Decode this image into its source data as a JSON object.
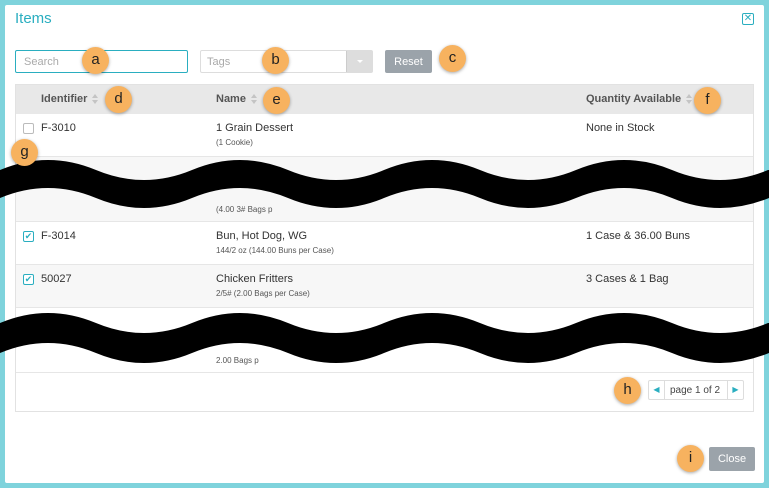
{
  "window": {
    "title": "Items"
  },
  "toolbar": {
    "search_placeholder": "Search",
    "tags_placeholder": "Tags",
    "reset_label": "Reset"
  },
  "table": {
    "columns": [
      "Identifier",
      "Name",
      "Quantity Available"
    ],
    "rows": [
      {
        "checked": false,
        "id": "F-3010",
        "name": "1 Grain Dessert",
        "pack": "(1 Cookie)",
        "qty": "None in Stock"
      },
      {
        "checked": false,
        "id": "",
        "name": "",
        "pack": "(4.00 3# Bags p",
        "qty": ""
      },
      {
        "checked": true,
        "id": "F-3014",
        "name": "Bun, Hot Dog, WG",
        "pack": "144/2 oz (144.00 Buns per Case)",
        "qty": "1 Case & 36.00 Buns"
      },
      {
        "checked": true,
        "id": "50027",
        "name": "Chicken Fritters",
        "pack": "2/5# (2.00 Bags per Case)",
        "qty": "3 Cases & 1 Bag"
      },
      {
        "checked": false,
        "id": "",
        "name": "",
        "pack": "2.00 Bags p",
        "qty": ""
      }
    ]
  },
  "pager": {
    "label": "page 1 of 2"
  },
  "footer": {
    "close_label": "Close"
  },
  "callouts": [
    "a",
    "b",
    "c",
    "d",
    "e",
    "f",
    "g",
    "h",
    "i"
  ],
  "colors": {
    "accent": "#2aaec0",
    "callout": "#f7b25f",
    "frame": "#7fd3dc",
    "button_gray": "#9ba3aa"
  }
}
